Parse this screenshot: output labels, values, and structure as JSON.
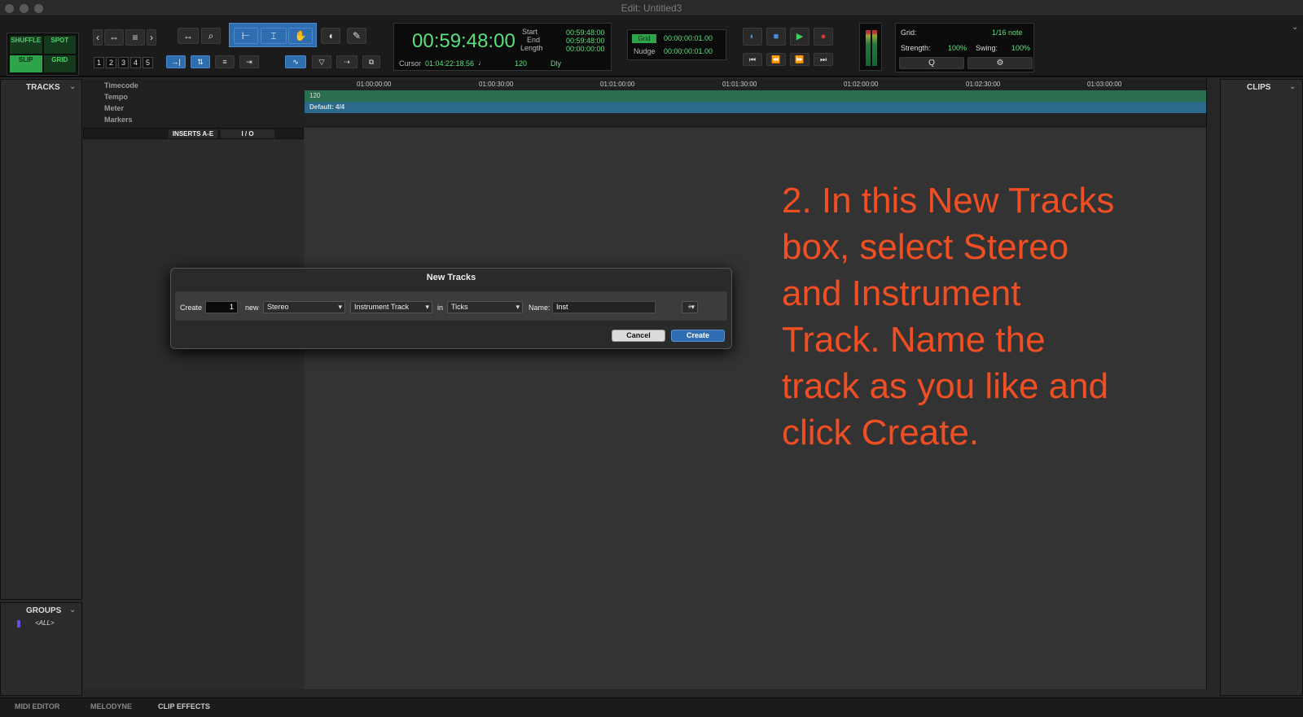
{
  "window": {
    "title": "Edit: Untitled3"
  },
  "edit_modes": [
    {
      "label": "SHUFFLE",
      "active": false
    },
    {
      "label": "SPOT",
      "active": false
    },
    {
      "label": "SLIP",
      "active": true
    },
    {
      "label": "GRID",
      "active": false
    }
  ],
  "zoom_presets": [
    "1",
    "2",
    "3",
    "4",
    "5"
  ],
  "counter": {
    "main": "00:59:48:00",
    "start_label": "Start",
    "start": "00:59:48:00",
    "end_label": "End",
    "end": "00:59:48:00",
    "length_label": "Length",
    "length": "00:00:00:00",
    "cursor_label": "Cursor",
    "cursor": "01:04:22:18.56",
    "tempo": "120",
    "dly_label": "Dly"
  },
  "grid_nudge": {
    "grid_label": "Grid",
    "grid_value": "00:00:00:01.00",
    "nudge_label": "Nudge",
    "nudge_value": "00:00:00:01.00"
  },
  "grid_panel": {
    "grid_label": "Grid:",
    "grid_value": "1/16 note",
    "strength_label": "Strength:",
    "strength_value": "100%",
    "swing_label": "Swing:",
    "swing_value": "100%"
  },
  "left_panel": {
    "tracks_label": "TRACKS",
    "groups_label": "GROUPS",
    "all_group": "<ALL>"
  },
  "right_panel": {
    "clips_label": "CLIPS"
  },
  "rulers": {
    "rows": [
      "Timecode",
      "Tempo",
      "Meter",
      "Markers"
    ],
    "timecode_ticks": [
      "01:00:00:00",
      "01:00:30:00",
      "01:01:00:00",
      "01:01:30:00",
      "01:02:00:00",
      "01:02:30:00",
      "01:03:00:00"
    ],
    "tempo_value": "120",
    "meter_value": "Default: 4/4"
  },
  "track_header": {
    "inserts_label": "INSERTS A-E",
    "io_label": "I / O"
  },
  "dialog": {
    "title": "New Tracks",
    "create_label": "Create",
    "count_value": "1",
    "new_label": "new",
    "format_value": "Stereo",
    "type_value": "Instrument Track",
    "in_label": "in",
    "timebase_value": "Ticks",
    "name_label": "Name:",
    "name_value": "Inst",
    "add_label": "+",
    "cancel_label": "Cancel",
    "create_button_label": "Create"
  },
  "instruction_text": "2. In this New Tracks box, select Stereo and Instrument Track. Name the track as you like and click Create.",
  "bottom_tabs": [
    "MIDI EDITOR",
    "MELODYNE",
    "CLIP EFFECTS"
  ],
  "colors": {
    "accent_green": "#5ce07b",
    "active_blue": "#2d6db0",
    "instruction_red": "#f04e23",
    "tempo_ruler": "#2a6e4f",
    "meter_ruler": "#2b6a8a"
  }
}
